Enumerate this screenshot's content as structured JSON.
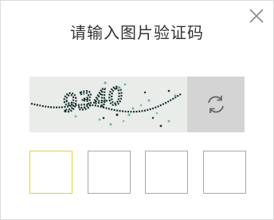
{
  "dialog": {
    "title": "请输入图片验证码",
    "close_icon": "close-icon",
    "refresh_icon": "refresh-icon",
    "captcha_text": "9340",
    "code_inputs": [
      "",
      "",
      "",
      ""
    ],
    "active_input_color": "#e8d32a",
    "captcha_ink_color": "#15302f",
    "captcha_noise_color": "#66b9ad"
  }
}
